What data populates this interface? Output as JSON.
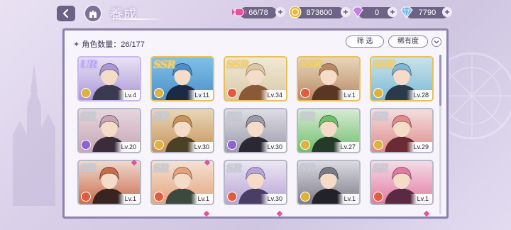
{
  "header": {
    "title": "養成",
    "back_icon": "chevron-left-icon",
    "home_icon": "castle-icon"
  },
  "resources": [
    {
      "name": "stamina",
      "icon": "candy-icon",
      "value": "66/78",
      "color": "#e2519a"
    },
    {
      "name": "gold",
      "icon": "coin-icon",
      "value": "873600",
      "color": "#e8b63a"
    },
    {
      "name": "gem",
      "icon": "gem-icon",
      "value": "0",
      "color": "#c57be8"
    },
    {
      "name": "diamond",
      "icon": "diamond-icon",
      "value": "7790",
      "color": "#6fb7ec"
    }
  ],
  "panel": {
    "count_label": "角色数量：26/177",
    "filter_label": "筛 选",
    "rarity_label": "稀有度",
    "sort_icon": "chevron-down-icon"
  },
  "cards": [
    {
      "rarity": "UR",
      "level": "Lv.4",
      "attr_color": "#e0b23b",
      "art": [
        "#a995d8",
        "#3c3a52",
        "#e9e2f3"
      ]
    },
    {
      "rarity": "SSR",
      "level": "Lv.11",
      "attr_color": "#e0b23b",
      "art": [
        "#4c8ec7",
        "#1d2a44",
        "#7fc0e8"
      ]
    },
    {
      "rarity": "SSR",
      "level": "Lv.34",
      "attr_color": "#e35b3e",
      "art": [
        "#d8c9a6",
        "#8a5a36",
        "#f1e9d6"
      ]
    },
    {
      "rarity": "SSR",
      "level": "Lv.1",
      "attr_color": "#e35b3e",
      "art": [
        "#b78963",
        "#5a3724",
        "#e9d5bb"
      ]
    },
    {
      "rarity": "SSR",
      "level": "Lv.28",
      "attr_color": "#e0b23b",
      "art": [
        "#7cb8d6",
        "#2a3a4c",
        "#c9e3ea"
      ]
    },
    {
      "rarity": "SR",
      "level": "Lv.20",
      "attr_color": "#8d63d2",
      "art": [
        "#c7a5b6",
        "#3a2c3a",
        "#e6d6dd"
      ]
    },
    {
      "rarity": "SR",
      "level": "Lv.30",
      "attr_color": "#e0b23b",
      "art": [
        "#c9925a",
        "#4c4026",
        "#e8d7b8"
      ]
    },
    {
      "rarity": "SR",
      "level": "Lv.30",
      "attr_color": "#8d63d2",
      "art": [
        "#9b9aa8",
        "#2a2933",
        "#dedde6"
      ]
    },
    {
      "rarity": "SR",
      "level": "Lv.27",
      "attr_color": "#e0b23b",
      "art": [
        "#6fbf6a",
        "#263a2a",
        "#d7ead4"
      ]
    },
    {
      "rarity": "SR",
      "level": "Lv.29",
      "attr_color": "#e0b23b",
      "art": [
        "#e08a8a",
        "#6a2b33",
        "#f3dede"
      ]
    },
    {
      "rarity": "SR",
      "level": "Lv.1",
      "attr_color": "#e35b3e",
      "art": [
        "#c96b4a",
        "#3a2420",
        "#efd9cf"
      ]
    },
    {
      "rarity": "SR",
      "level": "Lv.1",
      "attr_color": "#e35b3e",
      "art": [
        "#e6a27a",
        "#3b4a3c",
        "#f3e2d4"
      ]
    },
    {
      "rarity": "SR",
      "level": "Lv.30",
      "attr_color": "#e35b3e",
      "art": [
        "#b7a3d6",
        "#4a3d66",
        "#ece6f4"
      ]
    },
    {
      "rarity": "SR",
      "level": "Lv.1",
      "attr_color": "#e0b23b",
      "art": [
        "#7c7a86",
        "#22222a",
        "#dcdbe3"
      ]
    },
    {
      "rarity": "SR",
      "level": "Lv.1",
      "attr_color": "#e35b3e",
      "art": [
        "#e07aa0",
        "#5a2a44",
        "#f5dce6"
      ]
    }
  ]
}
